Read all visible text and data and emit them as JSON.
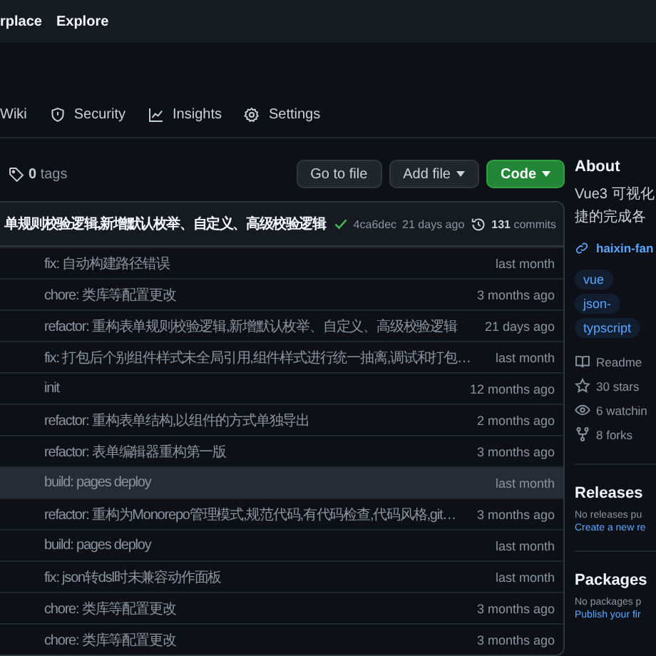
{
  "top_nav": [
    "rplace",
    "Explore"
  ],
  "repo_tabs": [
    {
      "label": "Wiki"
    },
    {
      "label": "Security"
    },
    {
      "label": "Insights"
    },
    {
      "label": "Settings"
    }
  ],
  "toolbar": {
    "tags": "**0** tags",
    "buttons": [
      {
        "label": "Go to file",
        "kind": "plain"
      },
      {
        "label": "Add file",
        "kind": "dropdown"
      },
      {
        "label": "Code",
        "kind": "primary"
      }
    ]
  },
  "latest_commit": {
    "message": "单规则校验逻辑,新增默认枚举、自定义、高级校验逻辑",
    "sha": "4ca6dec",
    "time": "21 days ago",
    "commits": "**131** commits"
  },
  "files": [
    {
      "message": "fix: 自动构建路径错误",
      "time": "last month",
      "highlighted": false
    },
    {
      "message": "chore: 类库等配置更改",
      "time": "3 months ago",
      "highlighted": false
    },
    {
      "message": "refactor: 重构表单规则校验逻辑,新增默认枚举、自定义、高级校验逻辑",
      "time": "21 days ago",
      "highlighted": false
    },
    {
      "message": "fix: 打包后个别组件样式未全局引用,组件样式进行统一抽离,调试和打包…",
      "time": "last month",
      "highlighted": false
    },
    {
      "message": "init",
      "time": "12 months ago",
      "highlighted": false
    },
    {
      "message": "refactor: 重构表单结构,以组件的方式单独导出",
      "time": "2 months ago",
      "highlighted": false
    },
    {
      "message": "refactor: 表单编辑器重构第一版",
      "time": "3 months ago",
      "highlighted": false
    },
    {
      "message": "build: pages deploy",
      "time": "last month",
      "highlighted": true
    },
    {
      "message": "refactor: 重构为Monorepo管理模式,规范代码,有代码检查,代码风格,git…",
      "time": "3 months ago",
      "highlighted": false
    },
    {
      "message": "build: pages deploy",
      "time": "last month",
      "highlighted": false
    },
    {
      "message": "fix: json转dsl时未兼容动作面板",
      "time": "last month",
      "highlighted": false
    },
    {
      "message": "chore: 类库等配置更改",
      "time": "3 months ago",
      "highlighted": false
    },
    {
      "message": "chore: 类库等配置更改",
      "time": "3 months ago",
      "highlighted": false
    }
  ],
  "about": {
    "title": "About",
    "description": [
      "Vue3 可视化",
      "捷的完成各"
    ],
    "link": "haixin-fan",
    "topics": [
      "vue",
      "json-",
      "typscript"
    ],
    "stats": [
      "Readme",
      "30 stars",
      "6 watchin",
      "8 forks"
    ]
  },
  "releases": {
    "title": "Releases",
    "text": "No releases pu",
    "link": "Create a new re"
  },
  "packages": {
    "title": "Packages",
    "text": "No packages p",
    "link": "Publish your fir"
  }
}
